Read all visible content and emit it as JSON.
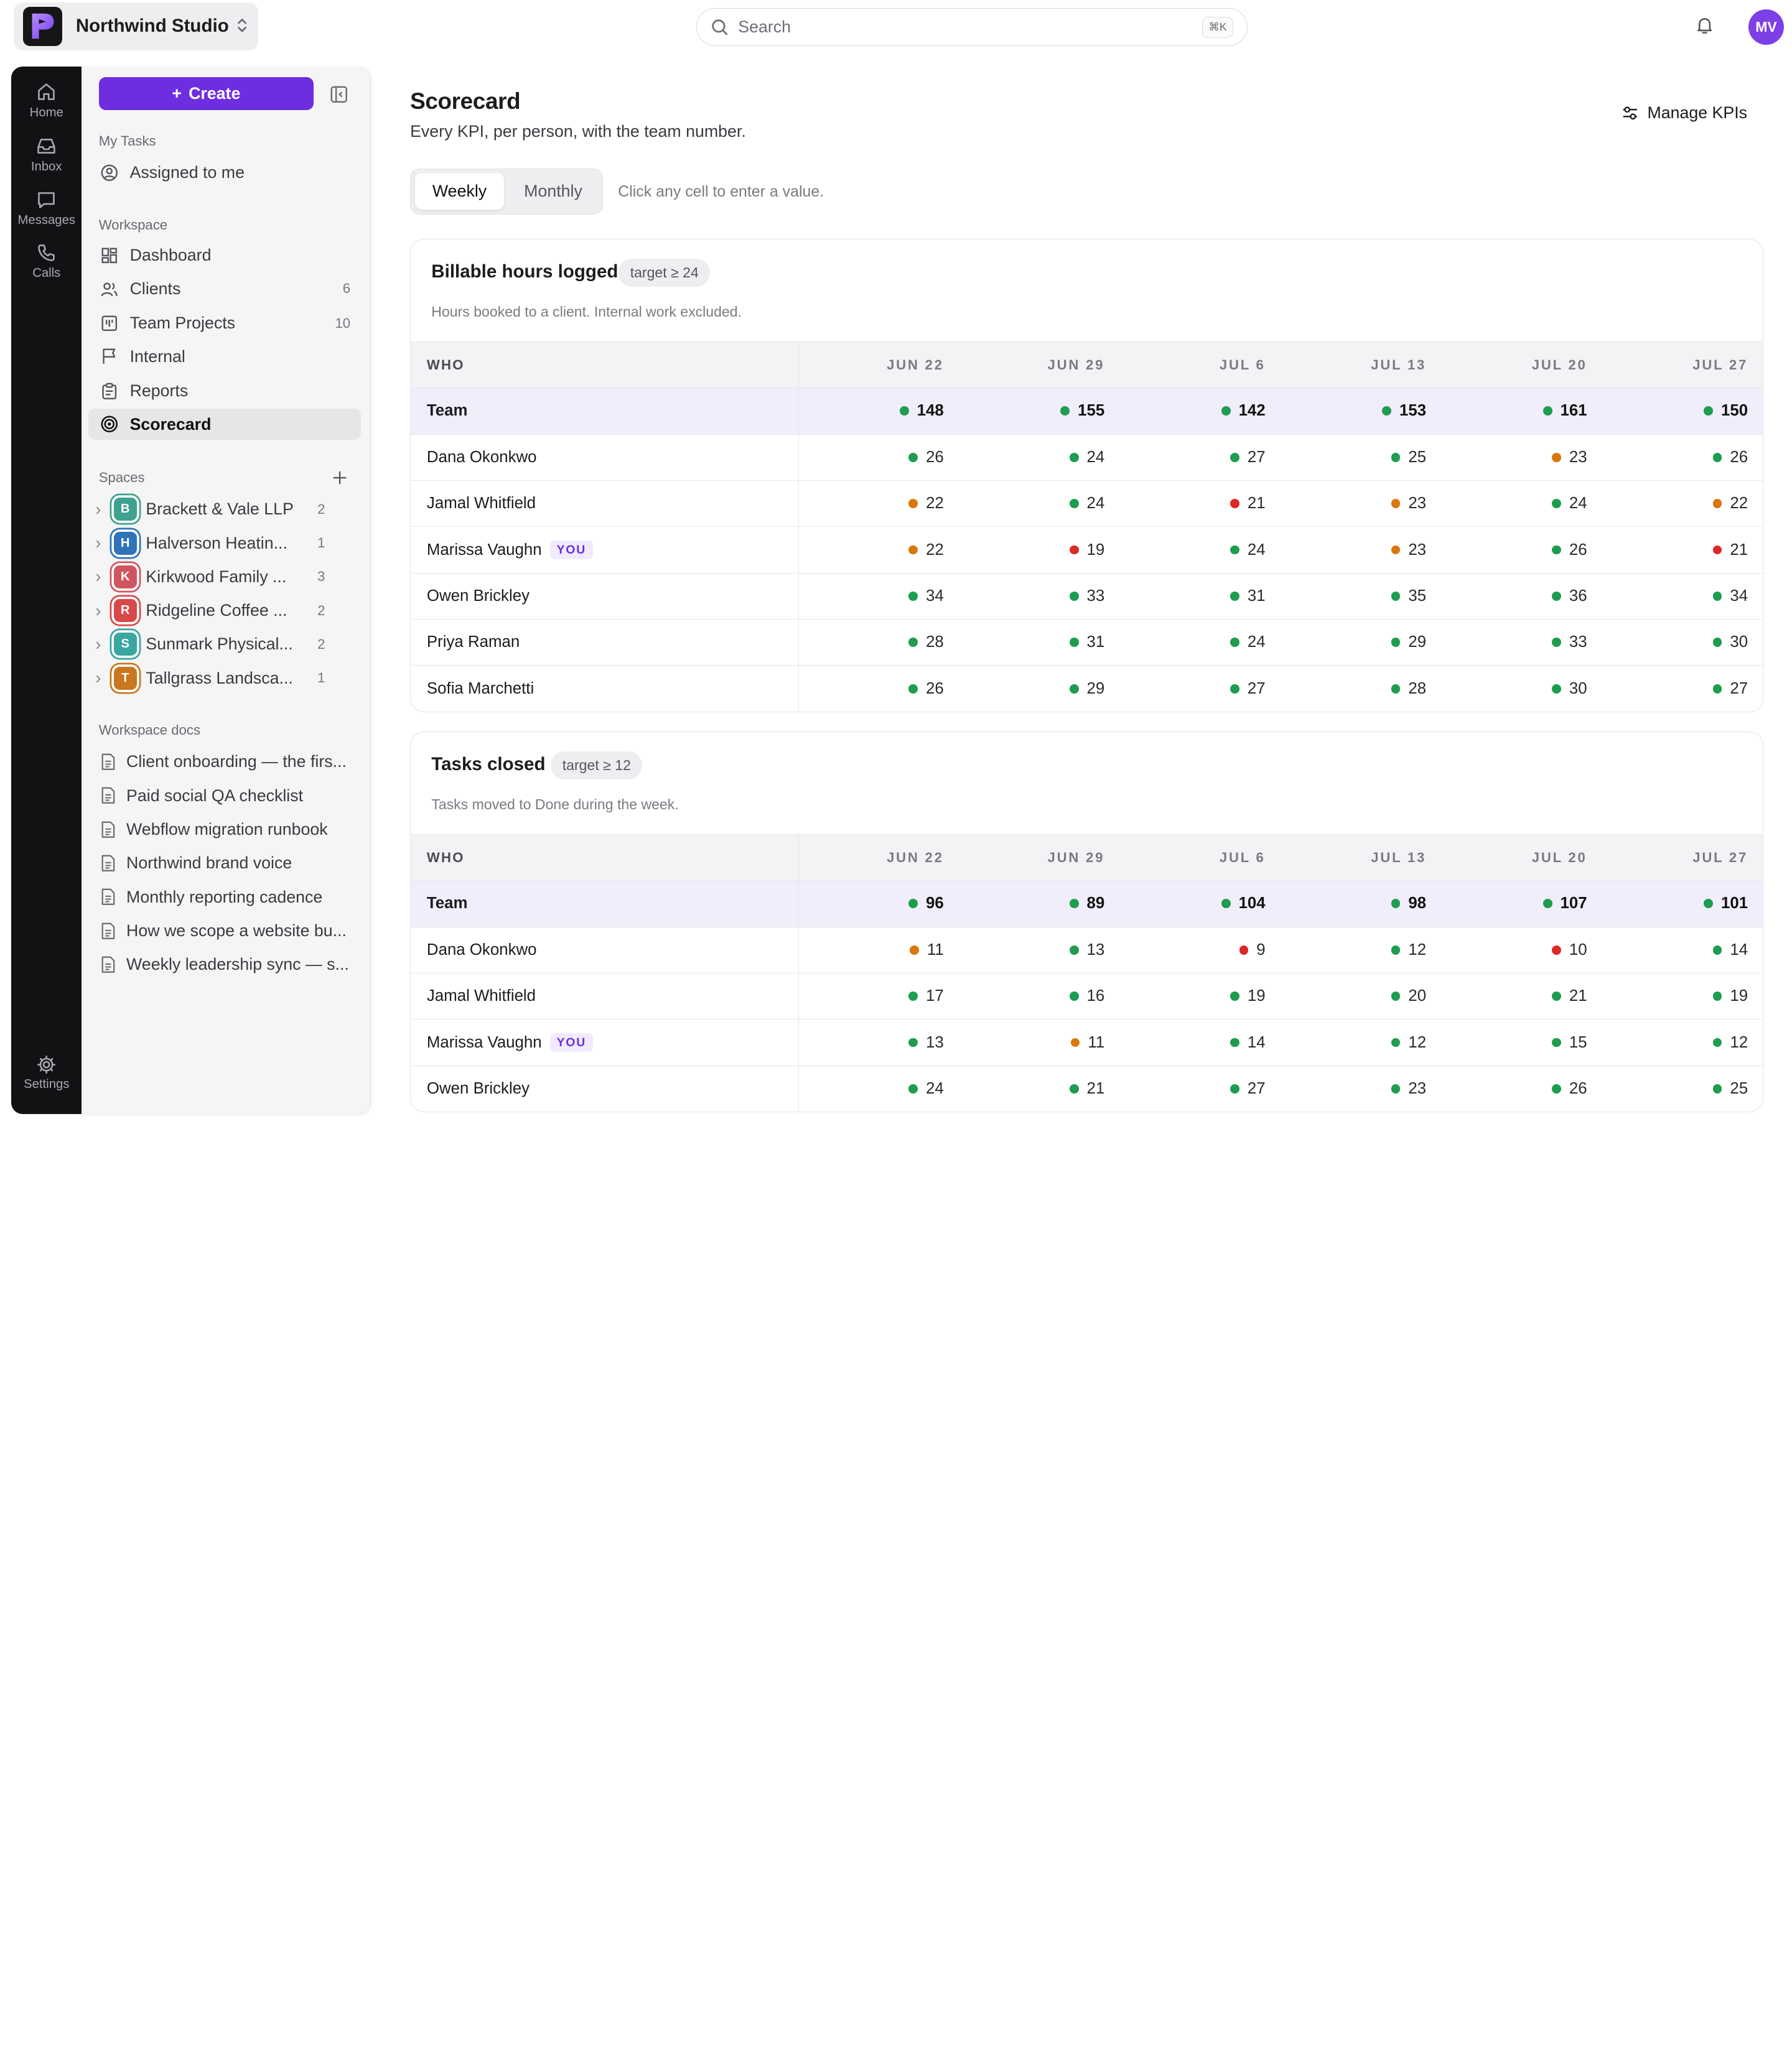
{
  "workspace": {
    "name": "Northwind Studio"
  },
  "search": {
    "placeholder": "Search",
    "shortcut": "⌘K"
  },
  "user": {
    "initials": "MV"
  },
  "rail": {
    "items": [
      {
        "label": "Home",
        "icon": "home-icon"
      },
      {
        "label": "Inbox",
        "icon": "inbox-icon"
      },
      {
        "label": "Messages",
        "icon": "messages-icon"
      },
      {
        "label": "Calls",
        "icon": "phone-icon"
      }
    ],
    "settings_label": "Settings"
  },
  "sidebar": {
    "create_label": "Create",
    "my_tasks_label": "My Tasks",
    "assigned_label": "Assigned to me",
    "workspace_label": "Workspace",
    "workspace_items": [
      {
        "label": "Dashboard",
        "count": ""
      },
      {
        "label": "Clients",
        "count": "6"
      },
      {
        "label": "Team Projects",
        "count": "10"
      },
      {
        "label": "Internal",
        "count": ""
      },
      {
        "label": "Reports",
        "count": ""
      },
      {
        "label": "Scorecard",
        "count": ""
      }
    ],
    "spaces_label": "Spaces",
    "spaces": [
      {
        "letter": "B",
        "name": "Brackett & Vale LLP",
        "count": "2",
        "color": "#3fa18f"
      },
      {
        "letter": "H",
        "name": "Halverson Heatin...",
        "count": "1",
        "color": "#2f73b8"
      },
      {
        "letter": "K",
        "name": "Kirkwood Family ...",
        "count": "3",
        "color": "#d0555e"
      },
      {
        "letter": "R",
        "name": "Ridgeline Coffee ...",
        "count": "2",
        "color": "#d94848"
      },
      {
        "letter": "S",
        "name": "Sunmark Physical...",
        "count": "2",
        "color": "#39a6a0"
      },
      {
        "letter": "T",
        "name": "Tallgrass Landsca...",
        "count": "1",
        "color": "#c9771f"
      }
    ],
    "docs_label": "Workspace docs",
    "docs": [
      "Client onboarding — the firs...",
      "Paid social QA checklist",
      "Webflow migration runbook",
      "Northwind brand voice",
      "Monthly reporting cadence",
      "How we scope a website bu...",
      "Weekly leadership sync — s..."
    ]
  },
  "main": {
    "title": "Scorecard",
    "subtitle": "Every KPI, per person, with the team number.",
    "manage_label": "Manage KPIs",
    "tabs": [
      "Weekly",
      "Monthly"
    ],
    "hint": "Click any cell to enter a value.",
    "who_label": "WHO",
    "you_label": "YOU",
    "weeks": [
      "JUN 22",
      "JUN 29",
      "JUL 6",
      "JUL 13",
      "JUL 20",
      "JUL 27"
    ],
    "status_colors": {
      "g": "#1f9d4f",
      "o": "#d9770c",
      "r": "#dc2828"
    },
    "kpis": [
      {
        "title": "Billable hours logged",
        "target": "target ≥ 24",
        "description": "Hours booked to a client. Internal work excluded.",
        "rows": [
          {
            "who": "Team",
            "team": true,
            "values": [
              "148",
              "155",
              "142",
              "153",
              "161",
              "150"
            ],
            "status": [
              "g",
              "g",
              "g",
              "g",
              "g",
              "g"
            ]
          },
          {
            "who": "Dana Okonkwo",
            "values": [
              "26",
              "24",
              "27",
              "25",
              "23",
              "26"
            ],
            "status": [
              "g",
              "g",
              "g",
              "g",
              "o",
              "g"
            ]
          },
          {
            "who": "Jamal Whitfield",
            "values": [
              "22",
              "24",
              "21",
              "23",
              "24",
              "22"
            ],
            "status": [
              "o",
              "g",
              "r",
              "o",
              "g",
              "o"
            ]
          },
          {
            "who": "Marissa Vaughn",
            "you": true,
            "values": [
              "22",
              "19",
              "24",
              "23",
              "26",
              "21"
            ],
            "status": [
              "o",
              "r",
              "g",
              "o",
              "g",
              "r"
            ]
          },
          {
            "who": "Owen Brickley",
            "values": [
              "34",
              "33",
              "31",
              "35",
              "36",
              "34"
            ],
            "status": [
              "g",
              "g",
              "g",
              "g",
              "g",
              "g"
            ]
          },
          {
            "who": "Priya Raman",
            "values": [
              "28",
              "31",
              "24",
              "29",
              "33",
              "30"
            ],
            "status": [
              "g",
              "g",
              "g",
              "g",
              "g",
              "g"
            ]
          },
          {
            "who": "Sofia Marchetti",
            "values": [
              "26",
              "29",
              "27",
              "28",
              "30",
              "27"
            ],
            "status": [
              "g",
              "g",
              "g",
              "g",
              "g",
              "g"
            ]
          }
        ]
      },
      {
        "title": "Tasks closed",
        "target": "target ≥ 12",
        "description": "Tasks moved to Done during the week.",
        "rows": [
          {
            "who": "Team",
            "team": true,
            "values": [
              "96",
              "89",
              "104",
              "98",
              "107",
              "101"
            ],
            "status": [
              "g",
              "g",
              "g",
              "g",
              "g",
              "g"
            ]
          },
          {
            "who": "Dana Okonkwo",
            "values": [
              "11",
              "13",
              "9",
              "12",
              "10",
              "14"
            ],
            "status": [
              "o",
              "g",
              "r",
              "g",
              "r",
              "g"
            ]
          },
          {
            "who": "Jamal Whitfield",
            "values": [
              "17",
              "16",
              "19",
              "20",
              "21",
              "19"
            ],
            "status": [
              "g",
              "g",
              "g",
              "g",
              "g",
              "g"
            ]
          },
          {
            "who": "Marissa Vaughn",
            "you": true,
            "values": [
              "13",
              "11",
              "14",
              "12",
              "15",
              "12"
            ],
            "status": [
              "g",
              "o",
              "g",
              "g",
              "g",
              "g"
            ]
          },
          {
            "who": "Owen Brickley",
            "values": [
              "24",
              "21",
              "27",
              "23",
              "26",
              "25"
            ],
            "status": [
              "g",
              "g",
              "g",
              "g",
              "g",
              "g"
            ]
          }
        ]
      }
    ]
  }
}
